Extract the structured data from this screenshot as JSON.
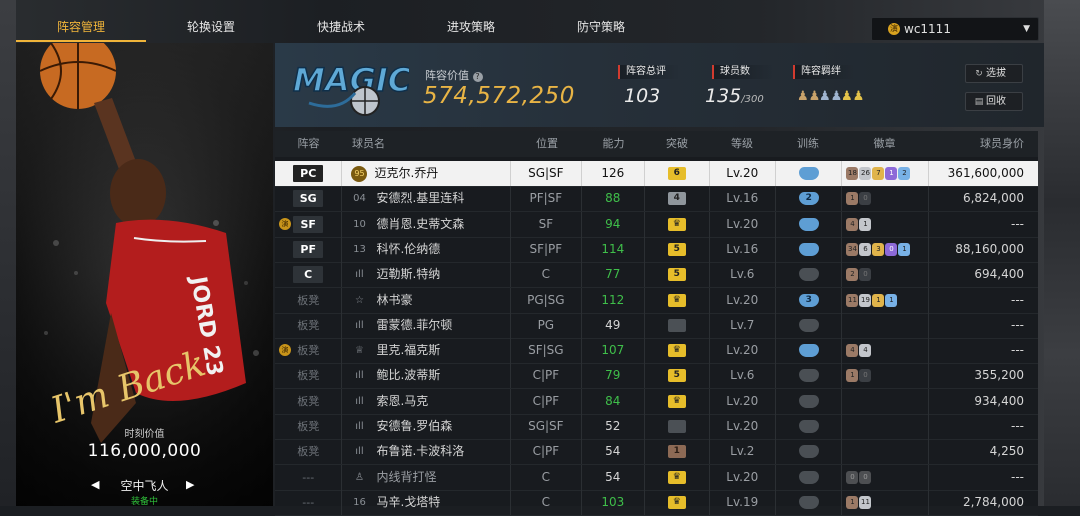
{
  "tabs": [
    {
      "label": "阵容管理",
      "active": true
    },
    {
      "label": "轮换设置",
      "active": false
    },
    {
      "label": "快捷战术",
      "active": false
    },
    {
      "label": "进攻策略",
      "active": false
    },
    {
      "label": "防守策略",
      "active": false
    }
  ],
  "user": {
    "badge": "演",
    "name": "wc1111"
  },
  "card": {
    "value_label": "时刻价值",
    "value": "116,000,000",
    "name": "空中飞人",
    "status": "装备中",
    "signature": "I'm Back",
    "jersey": "JORD 23"
  },
  "header": {
    "team_logo": "MAGIC",
    "lineup_value_label": "阵容价值",
    "lineup_value": "574,572,250",
    "rating_label": "阵容总评",
    "rating": "103",
    "players_label": "球员数",
    "players": "135",
    "players_max": "/300",
    "chem_label": "阵容羁绊",
    "select_button": "选拔",
    "recycle_button": "回收"
  },
  "table": {
    "headers": [
      "阵容",
      "球员名",
      "位置",
      "能力",
      "突破",
      "等级",
      "训练",
      "徽章",
      "球员身价"
    ],
    "rows": [
      {
        "slot": "PC",
        "pill": true,
        "crown": false,
        "tier": "95",
        "name": "迈克尔.乔丹",
        "pos": "SG|SF",
        "ability": "126",
        "ability_color": "normal",
        "breakthrough": "6",
        "brk_style": "gold",
        "level": "Lv.20",
        "train": "",
        "train_style": "blue",
        "badges": [
          [
            "18",
            "br"
          ],
          [
            "26",
            "sv"
          ],
          [
            "7",
            "gd"
          ],
          [
            "1",
            "pu"
          ],
          [
            "2",
            "bl"
          ]
        ],
        "value": "361,600,000",
        "selected": true
      },
      {
        "slot": "SG",
        "pill": true,
        "crown": false,
        "tier": "04",
        "name": "安德烈.基里连科",
        "pos": "PF|SF",
        "ability": "88",
        "ability_color": "green",
        "breakthrough": "4",
        "brk_style": "silver",
        "level": "Lv.16",
        "train": "2",
        "train_style": "blue",
        "badges": [
          [
            "1",
            "br"
          ],
          [
            "0",
            "dk"
          ]
        ],
        "value": "6,824,000",
        "selected": false
      },
      {
        "slot": "SF",
        "pill": true,
        "crown": true,
        "tier": "10",
        "name": "德肖恩.史蒂文森",
        "pos": "SF",
        "ability": "94",
        "ability_color": "green",
        "breakthrough": "♛",
        "brk_style": "gold",
        "level": "Lv.20",
        "train": "",
        "train_style": "blue",
        "badges": [
          [
            "4",
            "br"
          ],
          [
            "1",
            "sv"
          ]
        ],
        "value": "---",
        "selected": false
      },
      {
        "slot": "PF",
        "pill": true,
        "crown": false,
        "tier": "13",
        "name": "科怀.伦纳德",
        "pos": "SF|PF",
        "ability": "114",
        "ability_color": "green",
        "breakthrough": "5",
        "brk_style": "gold",
        "level": "Lv.16",
        "train": "",
        "train_style": "blue",
        "badges": [
          [
            "34",
            "br"
          ],
          [
            "6",
            "sv"
          ],
          [
            "3",
            "gd"
          ],
          [
            "0",
            "pu"
          ],
          [
            "1",
            "bl"
          ]
        ],
        "value": "88,160,000",
        "selected": false
      },
      {
        "slot": "C",
        "pill": true,
        "crown": false,
        "tier": "ıll",
        "name": "迈勒斯.特纳",
        "pos": "C",
        "ability": "77",
        "ability_color": "green",
        "breakthrough": "5",
        "brk_style": "gold",
        "level": "Lv.6",
        "train": "",
        "train_style": "grey",
        "badges": [
          [
            "2",
            "br"
          ],
          [
            "0",
            "dk"
          ]
        ],
        "value": "694,400",
        "selected": false
      },
      {
        "slot": "板凳",
        "pill": false,
        "crown": false,
        "tier": "☆",
        "name": "林书豪",
        "pos": "PG|SG",
        "ability": "112",
        "ability_color": "green",
        "breakthrough": "♛",
        "brk_style": "gold",
        "level": "Lv.20",
        "train": "3",
        "train_style": "blue",
        "badges": [
          [
            "11",
            "br"
          ],
          [
            "19",
            "sv"
          ],
          [
            "1",
            "gd"
          ],
          [
            "1",
            "bl"
          ]
        ],
        "value": "---",
        "selected": false
      },
      {
        "slot": "板凳",
        "pill": false,
        "crown": false,
        "tier": "ıll",
        "name": "雷蒙德.菲尔顿",
        "pos": "PG",
        "ability": "49",
        "ability_color": "normal",
        "breakthrough": "",
        "brk_style": "grey",
        "level": "Lv.7",
        "train": "",
        "train_style": "grey",
        "badges": [],
        "value": "---",
        "selected": false
      },
      {
        "slot": "板凳",
        "pill": false,
        "crown": true,
        "tier": "♕",
        "name": "里克.福克斯",
        "pos": "SF|SG",
        "ability": "107",
        "ability_color": "green",
        "breakthrough": "♛",
        "brk_style": "gold",
        "level": "Lv.20",
        "train": "",
        "train_style": "blue",
        "badges": [
          [
            "4",
            "br"
          ],
          [
            "4",
            "sv"
          ]
        ],
        "value": "---",
        "selected": false
      },
      {
        "slot": "板凳",
        "pill": false,
        "crown": false,
        "tier": "ıll",
        "name": "鲍比.波蒂斯",
        "pos": "C|PF",
        "ability": "79",
        "ability_color": "green",
        "breakthrough": "5",
        "brk_style": "gold",
        "level": "Lv.6",
        "train": "",
        "train_style": "grey",
        "badges": [
          [
            "1",
            "br"
          ],
          [
            "0",
            "dk"
          ]
        ],
        "value": "355,200",
        "selected": false
      },
      {
        "slot": "板凳",
        "pill": false,
        "crown": false,
        "tier": "ıll",
        "name": "索恩.马克",
        "pos": "C|PF",
        "ability": "84",
        "ability_color": "green",
        "breakthrough": "♛",
        "brk_style": "gold",
        "level": "Lv.20",
        "train": "",
        "train_style": "grey",
        "badges": [],
        "value": "934,400",
        "selected": false
      },
      {
        "slot": "板凳",
        "pill": false,
        "crown": false,
        "tier": "ıll",
        "name": "安德鲁.罗伯森",
        "pos": "SG|SF",
        "ability": "52",
        "ability_color": "normal",
        "breakthrough": "",
        "brk_style": "grey",
        "level": "Lv.20",
        "train": "",
        "train_style": "grey",
        "badges": [],
        "value": "---",
        "selected": false
      },
      {
        "slot": "板凳",
        "pill": false,
        "crown": false,
        "tier": "ıll",
        "name": "布鲁诺.卡波科洛",
        "pos": "C|PF",
        "ability": "54",
        "ability_color": "normal",
        "breakthrough": "1",
        "brk_style": "brown",
        "level": "Lv.2",
        "train": "",
        "train_style": "grey",
        "badges": [],
        "value": "4,250",
        "selected": false
      },
      {
        "slot": "---",
        "pill": false,
        "crown": false,
        "tier": "♙",
        "name": "内线背打怪",
        "pos": "C",
        "ability": "54",
        "ability_color": "normal",
        "breakthrough": "♛",
        "brk_style": "gold",
        "level": "Lv.20",
        "train": "",
        "train_style": "grey",
        "badges": [
          [
            "0",
            "hid"
          ],
          [
            "0",
            "hid"
          ]
        ],
        "value": "---",
        "selected": false,
        "dim": true
      },
      {
        "slot": "---",
        "pill": false,
        "crown": false,
        "tier": "16",
        "name": "马辛.戈塔特",
        "pos": "C",
        "ability": "103",
        "ability_color": "green",
        "breakthrough": "♛",
        "brk_style": "gold",
        "level": "Lv.19",
        "train": "",
        "train_style": "grey",
        "badges": [
          [
            "1",
            "br"
          ],
          [
            "11",
            "sv"
          ]
        ],
        "value": "2,784,000",
        "selected": false
      }
    ]
  }
}
